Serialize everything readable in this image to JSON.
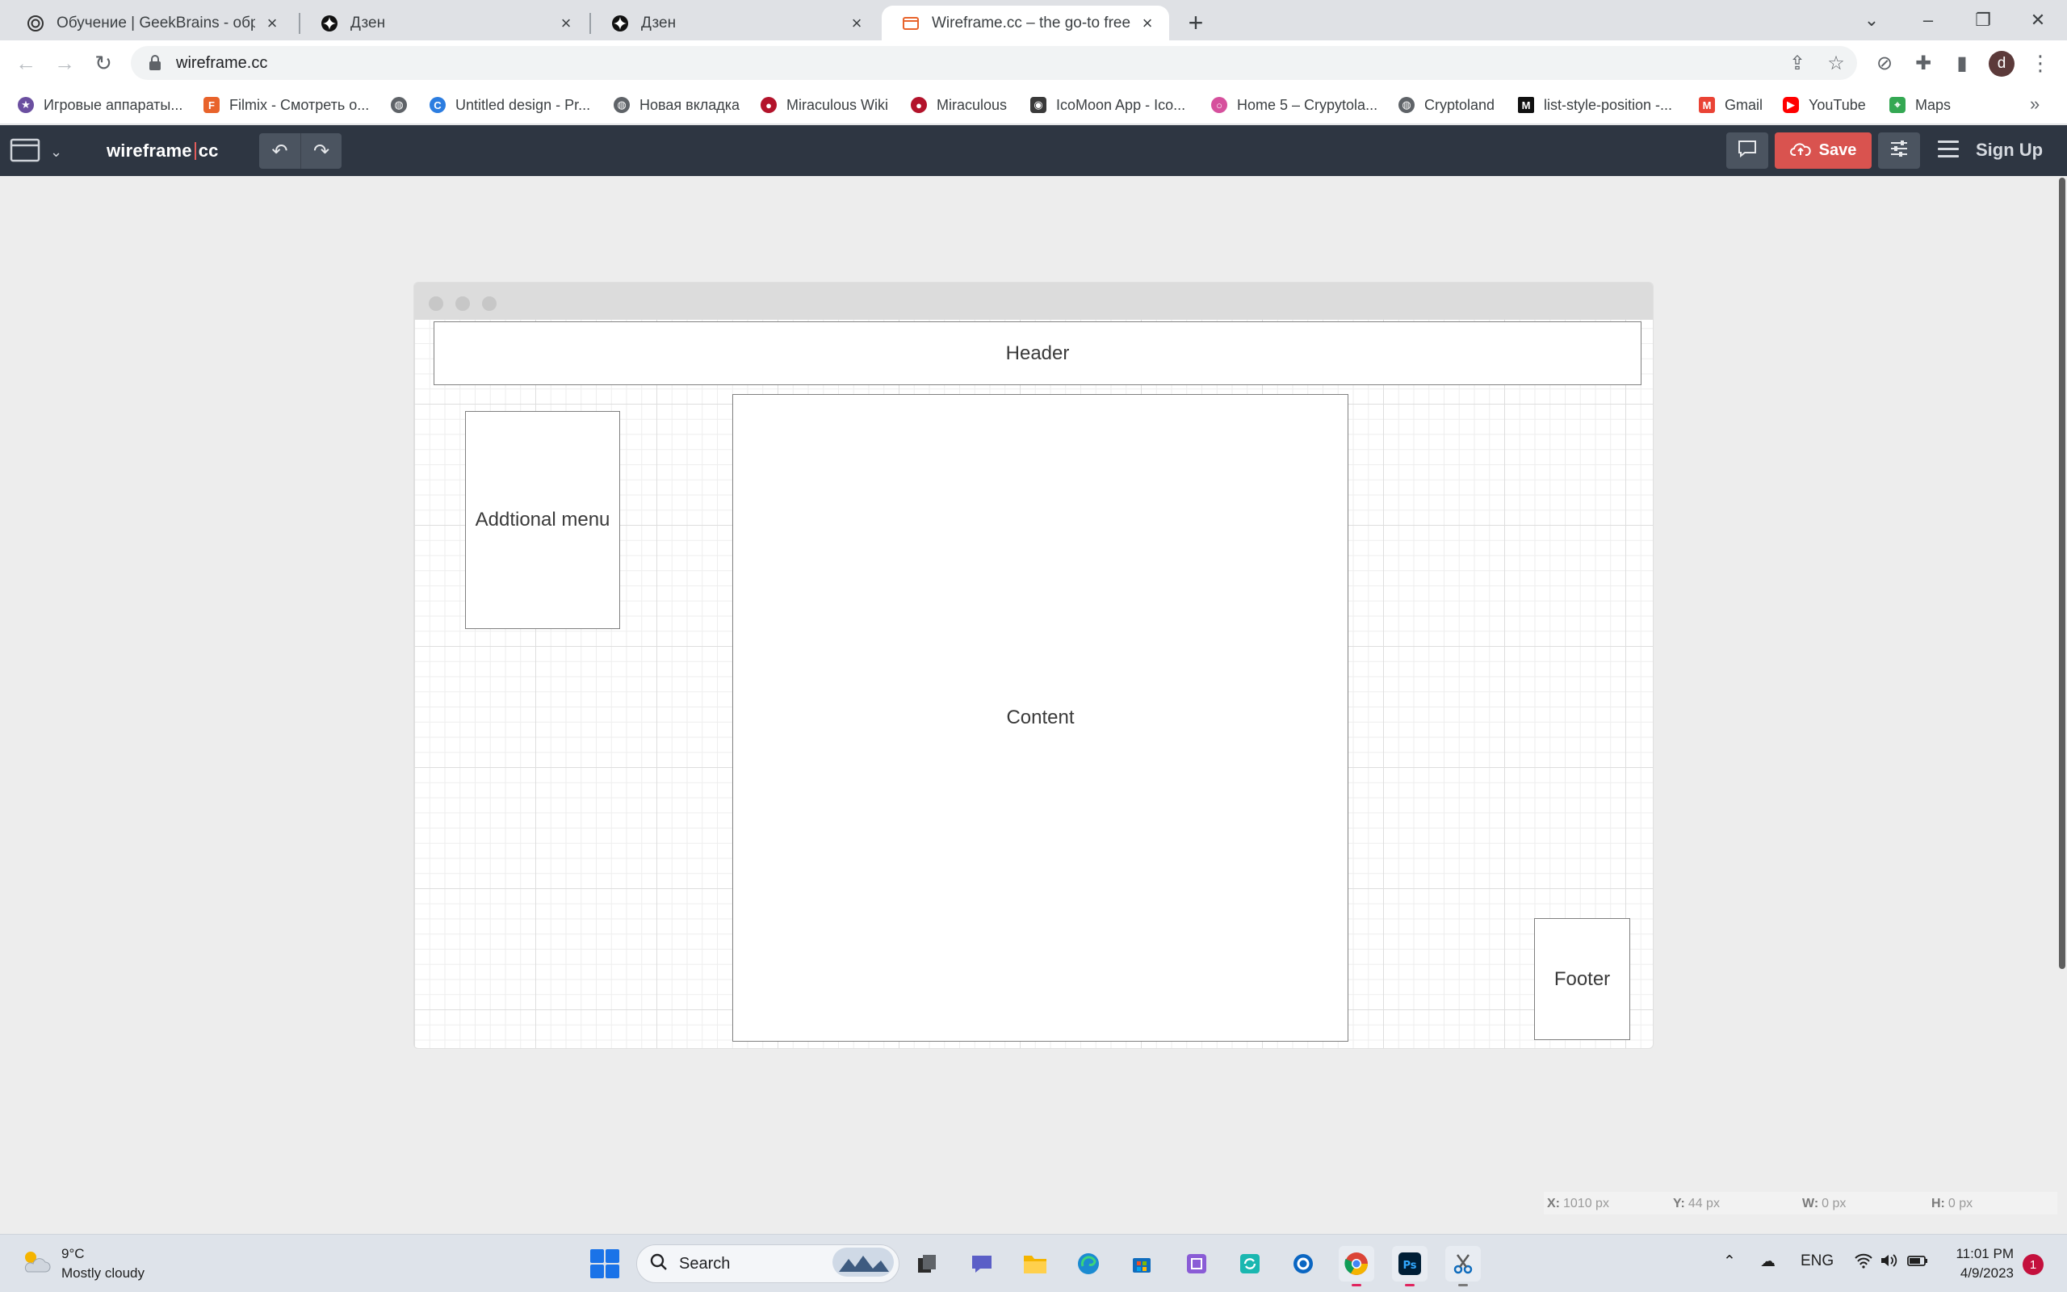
{
  "browser": {
    "tabs": [
      {
        "title": "Обучение | GeekBrains - образо",
        "favicon": "geekbrains-icon"
      },
      {
        "title": "Дзен",
        "favicon": "dzen-icon"
      },
      {
        "title": "Дзен",
        "favicon": "dzen-icon"
      },
      {
        "title": "Wireframe.cc – the go-to free, on",
        "favicon": "wireframe-icon",
        "active": true
      }
    ],
    "url": "wireframe.cc",
    "profile_initial": "d",
    "bookmarks": [
      {
        "label": "Игровые аппараты...",
        "icon": "star-icon",
        "color": "#6b4fa0"
      },
      {
        "label": "Filmix - Смотреть о...",
        "icon": "filmix-icon",
        "color": "#e8632b"
      },
      {
        "label": "",
        "icon": "globe-icon",
        "color": "#5f6368"
      },
      {
        "label": "Untitled design - Pr...",
        "icon": "canva-icon",
        "color": "#2c7de0"
      },
      {
        "label": "Новая вкладка",
        "icon": "globe-icon",
        "color": "#5f6368"
      },
      {
        "label": "Miraculous Wiki",
        "icon": "ladybug-icon",
        "color": "#b3132b"
      },
      {
        "label": "Miraculous",
        "icon": "ladybug-icon",
        "color": "#b3132b"
      },
      {
        "label": "IcoMoon App - Ico...",
        "icon": "icomoon-icon",
        "color": "#3a3a3a"
      },
      {
        "label": "Home 5 – Crypytola...",
        "icon": "ring-icon",
        "color": "#d6509d"
      },
      {
        "label": "Cryptoland",
        "icon": "globe-icon",
        "color": "#5f6368"
      },
      {
        "label": "list-style-position -...",
        "icon": "mdn-icon",
        "color": "#111111"
      },
      {
        "label": "Gmail",
        "icon": "gmail-icon",
        "color": "#ea4335"
      },
      {
        "label": "YouTube",
        "icon": "youtube-icon",
        "color": "#ff0000"
      },
      {
        "label": "Maps",
        "icon": "maps-icon",
        "color": "#34a853"
      }
    ]
  },
  "app": {
    "logo_left": "wireframe",
    "logo_right": "cc",
    "save_label": "Save",
    "signup_label": "Sign Up",
    "accent": "#d9534f"
  },
  "wireframe": {
    "header": "Header",
    "menu": "Addtional menu",
    "content": "Content",
    "footer": "Footer"
  },
  "readout": {
    "x": "1010 px",
    "y": "44 px",
    "w": "0 px",
    "h": "0 px"
  },
  "taskbar": {
    "temperature": "9°C",
    "weather": "Mostly cloudy",
    "search_placeholder": "Search",
    "language": "ENG",
    "time": "11:01 PM",
    "date": "4/9/2023",
    "notifications": "1"
  }
}
